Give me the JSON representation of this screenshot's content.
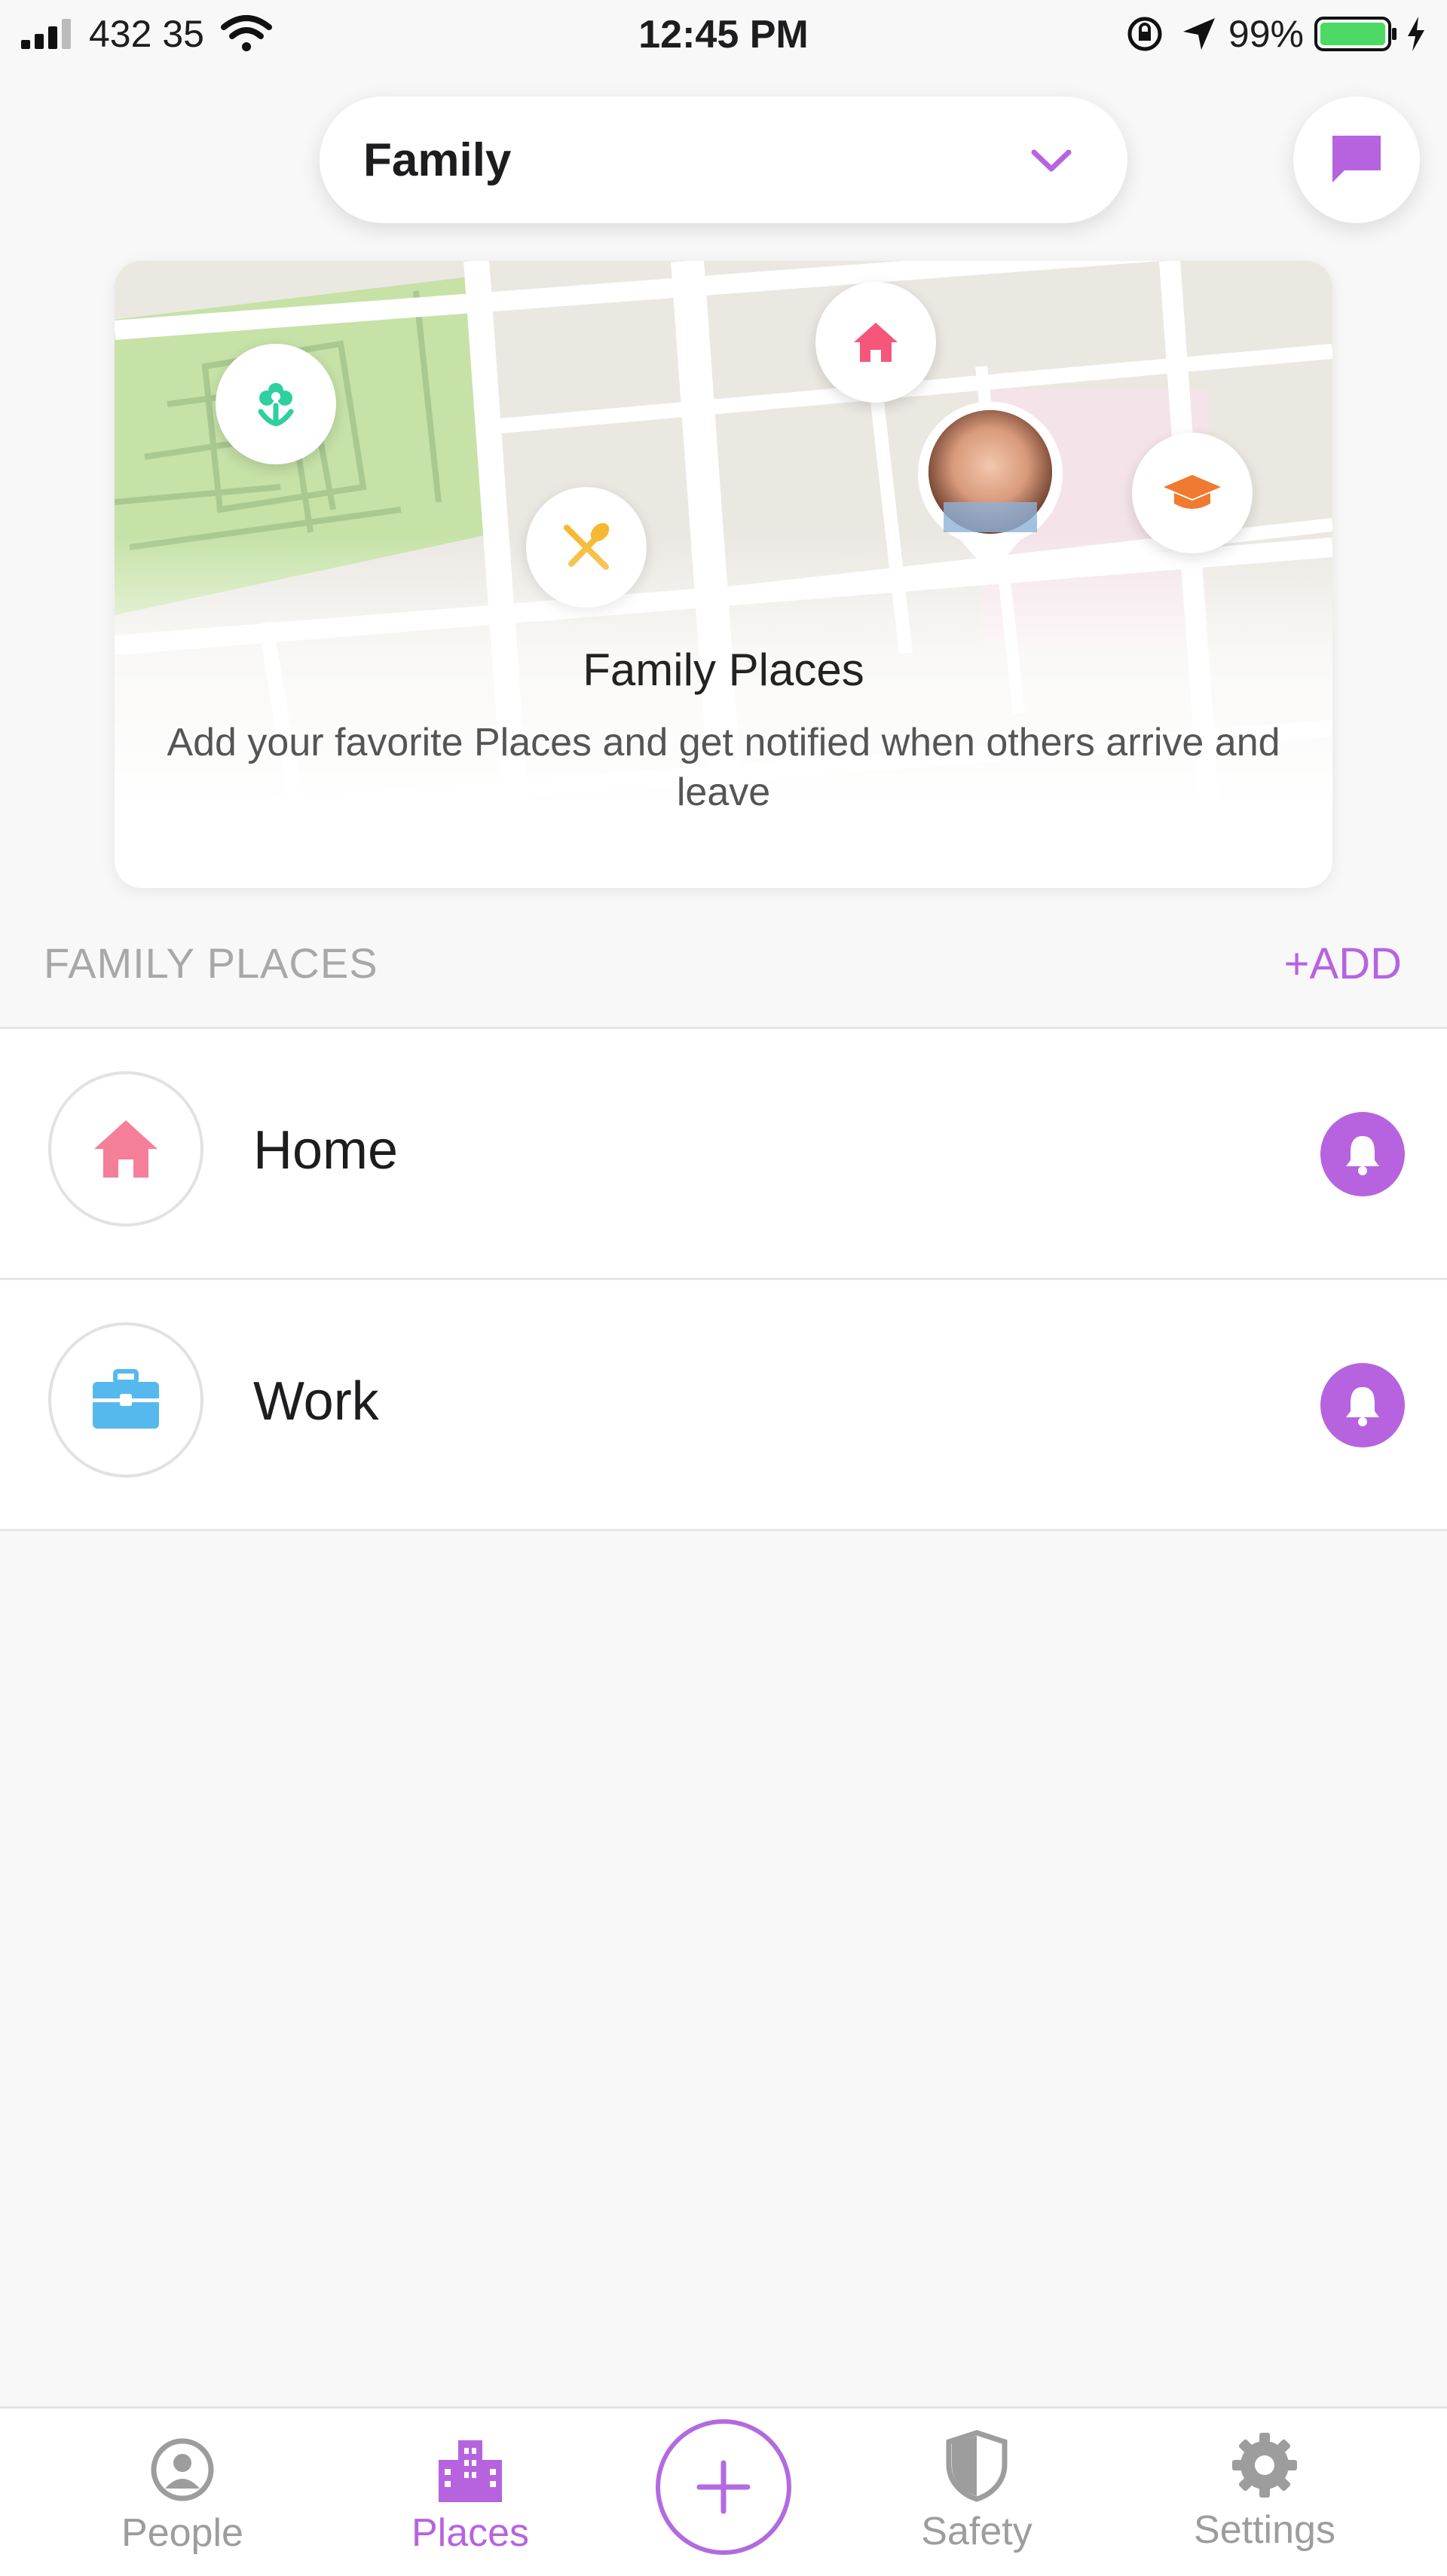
{
  "status_bar": {
    "carrier": "432 35",
    "time": "12:45 PM",
    "battery_percent": "99%"
  },
  "header": {
    "circle_name": "Family"
  },
  "map_card": {
    "title": "Family Places",
    "subtitle": "Add your favorite Places and get notified when others arrive and leave",
    "pins": [
      "flower-icon",
      "home-icon",
      "fork-knife-icon",
      "graduation-cap-icon",
      "avatar"
    ]
  },
  "section": {
    "label": "FAMILY PLACES",
    "add_label": "+ADD"
  },
  "places": [
    {
      "name": "Home",
      "icon": "home-icon",
      "icon_color": "#f57f98"
    },
    {
      "name": "Work",
      "icon": "briefcase-icon",
      "icon_color": "#56b9ee"
    }
  ],
  "tabs": [
    {
      "label": "People",
      "icon": "person-icon",
      "active": false
    },
    {
      "label": "Places",
      "icon": "buildings-icon",
      "active": true
    },
    {
      "label": "Safety",
      "icon": "shield-icon",
      "active": false
    },
    {
      "label": "Settings",
      "icon": "gear-icon",
      "active": false
    }
  ],
  "colors": {
    "accent": "#b763e0",
    "home": "#f57f98",
    "work": "#56b9ee",
    "park": "#c6e2a7",
    "flower": "#2fcf9f",
    "food": "#f5b830",
    "school": "#f07a2f"
  }
}
